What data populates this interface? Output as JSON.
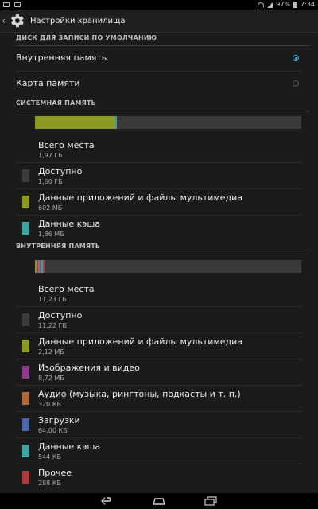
{
  "status_bar": {
    "battery": "97%",
    "time": "7:34"
  },
  "action_bar": {
    "title": "Настройки хранилища",
    "icon": "settings-gear-icon"
  },
  "default_disk": {
    "header": "ДИСК ДЛЯ ЗАПИСИ ПО УМОЛЧАНИЮ",
    "options": [
      {
        "label": "Внутренняя память",
        "selected": true
      },
      {
        "label": "Карта памяти",
        "selected": false
      }
    ]
  },
  "system_memory": {
    "header": "СИСТЕМНАЯ ПАМЯТЬ",
    "usage_bar": [
      {
        "color": "#8d9a22",
        "fraction": 0.3
      },
      {
        "color": "#3fa2a2",
        "fraction": 0.008
      }
    ],
    "items": [
      {
        "name": "Всего места",
        "value": "1,97 ГБ",
        "color": null
      },
      {
        "name": "Доступно",
        "value": "1,60 ГБ",
        "color": "#3b3b3b"
      },
      {
        "name": "Данные приложений и файлы мультимедиа",
        "value": "602 МБ",
        "color": "#8d9a22"
      },
      {
        "name": "Данные кэша",
        "value": "1,86 МБ",
        "color": "#3fa2a2"
      }
    ]
  },
  "internal_memory": {
    "header": "ВНУТРЕННЯЯ ПАМЯТЬ",
    "usage_bar": [
      {
        "color": "#8d9a22",
        "fraction": 0.006
      },
      {
        "color": "#8e3b8e",
        "fraction": 0.006
      },
      {
        "color": "#b0673a",
        "fraction": 0.006
      },
      {
        "color": "#4a67b0",
        "fraction": 0.006
      },
      {
        "color": "#3fa2a2",
        "fraction": 0.006
      },
      {
        "color": "#b03a3a",
        "fraction": 0.006
      }
    ],
    "items": [
      {
        "name": "Всего места",
        "value": "11,23 ГБ",
        "color": null
      },
      {
        "name": "Доступно",
        "value": "11,22 ГБ",
        "color": "#3b3b3b"
      },
      {
        "name": "Данные приложений и файлы мультимедиа",
        "value": "2,12 МБ",
        "color": "#8d9a22"
      },
      {
        "name": "Изображения и видео",
        "value": "8,72 МБ",
        "color": "#8e3b8e"
      },
      {
        "name": "Аудио (музыка, рингтоны, подкасты и т. п.)",
        "value": "320 КБ",
        "color": "#b0673a"
      },
      {
        "name": "Загрузки",
        "value": "64,00 КБ",
        "color": "#4a67b0"
      },
      {
        "name": "Данные кэша",
        "value": "544 КБ",
        "color": "#3fa2a2"
      },
      {
        "name": "Прочее",
        "value": "288 КБ",
        "color": "#b03a3a"
      }
    ]
  },
  "nav_bar": {
    "buttons": [
      "back-icon",
      "home-icon",
      "recents-icon"
    ]
  }
}
